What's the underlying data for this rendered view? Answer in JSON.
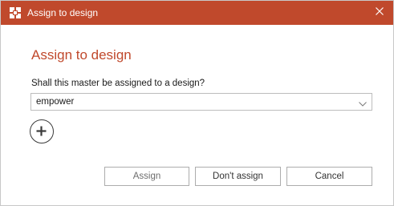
{
  "window": {
    "title": "Assign to design",
    "title_bar_color": "#c0492c",
    "icons": {
      "app": "app-logo-icon",
      "close": "close-icon"
    }
  },
  "dialog": {
    "heading": "Assign to design",
    "question": "Shall this master be assigned to a design?",
    "design_select": {
      "value": "empower",
      "icon": "chevron-down-icon"
    },
    "add_design_icon": "plus-icon"
  },
  "buttons": {
    "assign": "Assign",
    "dont_assign": "Don't assign",
    "cancel": "Cancel"
  }
}
